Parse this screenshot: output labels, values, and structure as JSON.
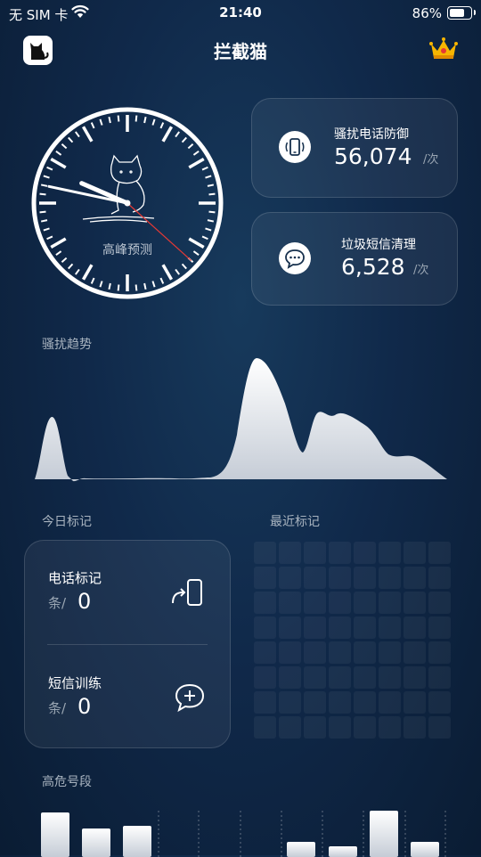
{
  "status_bar": {
    "carrier": "无 SIM 卡",
    "time": "21:40",
    "battery": "86%",
    "battery_level": 0.86
  },
  "header": {
    "title": "拦截猫",
    "logo_icon": "cat-logo-icon",
    "vip_icon": "crown-icon"
  },
  "clock": {
    "label": "高峰预测",
    "hour": 9,
    "minute": 47,
    "second": 22
  },
  "stats": [
    {
      "title": "骚扰电话防御",
      "value": "56,074",
      "unit": "/次",
      "icon": "phone-ringing-icon"
    },
    {
      "title": "垃圾短信清理",
      "value": "6,528",
      "unit": "/次",
      "icon": "message-bubble-icon"
    }
  ],
  "trend": {
    "title": "骚扰趋势"
  },
  "today_marks": {
    "title": "今日标记",
    "rows": [
      {
        "label": "电话标记",
        "unit": "条/",
        "count": "0",
        "icon": "phone-forward-icon"
      },
      {
        "label": "短信训练",
        "unit": "条/",
        "count": "0",
        "icon": "message-add-icon"
      }
    ]
  },
  "recent_marks": {
    "title": "最近标记"
  },
  "high_risk": {
    "title": "高危号段"
  }
}
